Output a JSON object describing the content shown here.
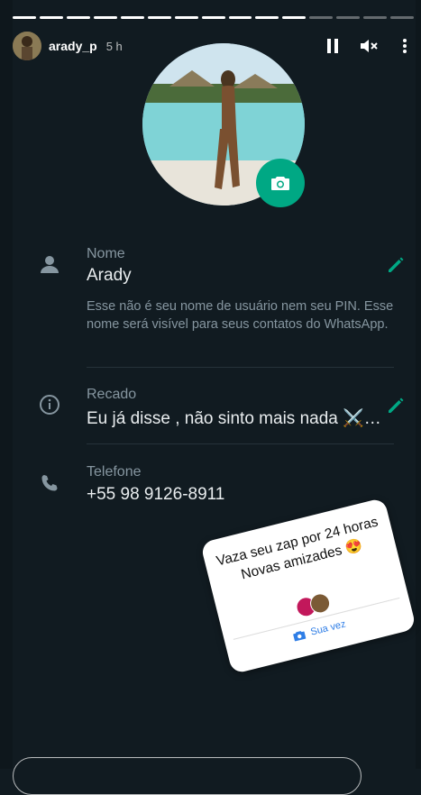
{
  "story": {
    "username": "arady_p",
    "time": "5 h",
    "progress_segments_total": 15,
    "progress_segments_viewed": 11
  },
  "profile": {
    "name_label": "Nome",
    "name_value": "Arady",
    "name_hint": "Esse não é seu nome de usuário nem seu PIN. Esse nome será visível para seus contatos do WhatsApp.",
    "about_label": "Recado",
    "about_value": "Eu já disse , não sinto mais nada ⚔️…",
    "phone_label": "Telefone",
    "phone_value": "+55 98 9126-8911"
  },
  "sticker": {
    "text": "Vaza seu zap por 24 horas Novas amizades 😍",
    "action_label": "Sua vez"
  },
  "icons": {
    "pause": "pause-icon",
    "mute": "speaker-muted-icon",
    "more": "more-vertical-icon",
    "camera": "camera-icon",
    "person": "person-icon",
    "info": "info-icon",
    "phone": "phone-icon",
    "edit": "pencil-icon"
  },
  "colors": {
    "background": "#111b21",
    "accent": "#00a884",
    "label": "#8696a0",
    "text": "#e9edef",
    "sticker_action": "#2f7ee6"
  }
}
